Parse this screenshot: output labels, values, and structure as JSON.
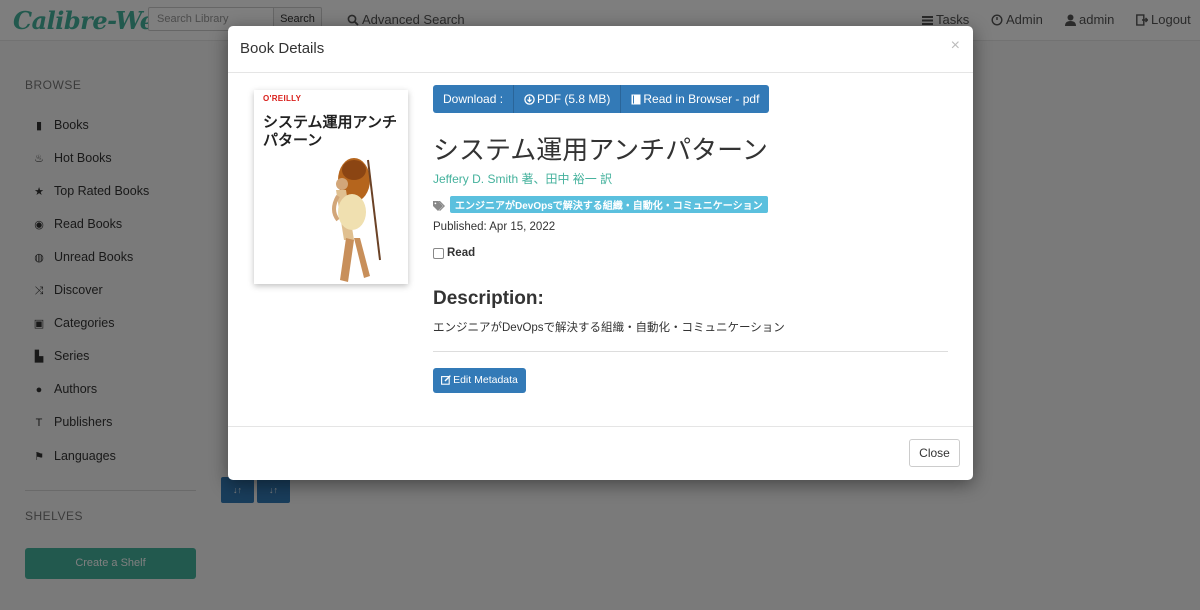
{
  "navbar": {
    "brand": "Calibre-Web",
    "search_placeholder": "Search Library",
    "search_button": "Search",
    "advanced_search": "Advanced Search",
    "tasks": "Tasks",
    "admin": "Admin",
    "user": "admin",
    "logout": "Logout"
  },
  "sidebar": {
    "browse_heading": "BROWSE",
    "items": [
      {
        "label": "Books",
        "icon": "book-icon"
      },
      {
        "label": "Hot Books",
        "icon": "fire-icon"
      },
      {
        "label": "Top Rated Books",
        "icon": "star-icon"
      },
      {
        "label": "Read Books",
        "icon": "eye-icon"
      },
      {
        "label": "Unread Books",
        "icon": "eye-slash-icon"
      },
      {
        "label": "Discover",
        "icon": "shuffle-icon"
      },
      {
        "label": "Categories",
        "icon": "inbox-icon"
      },
      {
        "label": "Series",
        "icon": "bookmark-icon"
      },
      {
        "label": "Authors",
        "icon": "user-icon"
      },
      {
        "label": "Publishers",
        "icon": "text-size-icon"
      },
      {
        "label": "Languages",
        "icon": "flag-icon"
      }
    ],
    "shelves_heading": "SHELVES",
    "create_shelf": "Create a Shelf"
  },
  "modal": {
    "title": "Book Details",
    "close_x": "×",
    "cover": {
      "publisher": "O'REILLY",
      "title": "システム運用アンチパターン"
    },
    "download": {
      "label": "Download :",
      "pdf": "PDF (5.8 MB)",
      "read_in_browser": "Read in Browser - pdf"
    },
    "book_title": "システム運用アンチパターン",
    "authors": "Jeffery D. Smith 著、田中 裕一 訳",
    "tag": "エンジニアがDevOpsで解決する組織・自動化・コミュニケーション",
    "published": "Published: Apr 15, 2022",
    "read_label": "Read",
    "description_heading": "Description:",
    "description_text": "エンジニアがDevOpsで解決する組織・自動化・コミュニケーション",
    "edit_metadata": "Edit Metadata",
    "close_button": "Close"
  }
}
